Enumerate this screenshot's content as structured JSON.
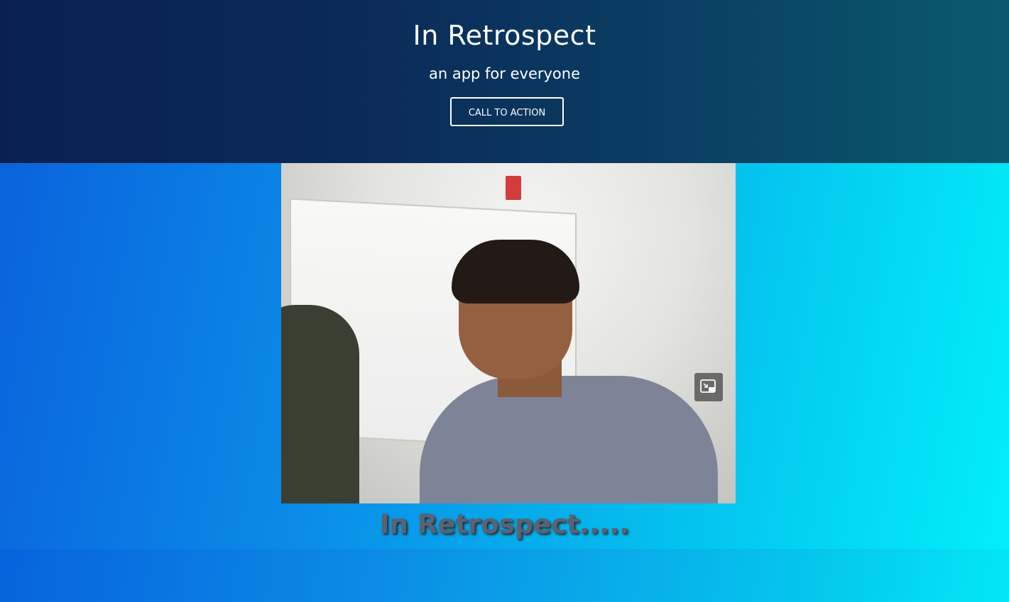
{
  "hero": {
    "title": "In Retrospect",
    "subtitle": "an app for everyone",
    "cta_label": "CALL TO ACTION"
  },
  "video": {
    "pip_icon": "picture-in-picture-icon",
    "caption": "In Retrospect....."
  },
  "colors": {
    "hero_bg": "#0b2a58",
    "stage_gradient_start": "#0a63db",
    "stage_gradient_end": "#02f0fa",
    "caption_text": "#5a6273"
  }
}
